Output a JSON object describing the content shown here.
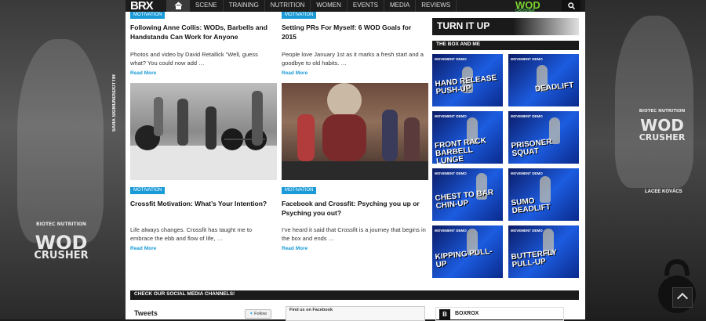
{
  "nav": {
    "logo": "BRX",
    "items": [
      "SCENE",
      "TRAINING",
      "NUTRITION",
      "WOMEN",
      "EVENTS",
      "MEDIA",
      "REVIEWS"
    ],
    "brand_logo": "WOD",
    "brand_logo_sub": "CRUSHER"
  },
  "side_left": {
    "name": "SARA SIGMUNDSDOTTIR",
    "shirt_line1": "WOD",
    "shirt_line2": "CRUSHER",
    "shirt_brand": "BIOTEC NUTRITION"
  },
  "side_right": {
    "name": "LACEE KOVÁCS",
    "shirt_line1": "WOD",
    "shirt_line2": "CRUSHER",
    "shirt_brand": "BIOTEC NUTRITION"
  },
  "articles": [
    {
      "tag": "MOTIVATION",
      "title": "Following Anne Collis: WODs, Barbells and Handstands Can Work for Anyone",
      "excerpt": "Photos and video by David Retallick “Well, guess what? You could now add …",
      "more": "Read More"
    },
    {
      "tag": "MOTIVATION",
      "title": "Setting PRs For Myself: 6 WOD Goals for 2015",
      "excerpt": "People love January 1st as it marks a fresh start and a goodbye to old habits. …",
      "more": "Read More"
    },
    {
      "tag": "MOTIVATION",
      "title": "Crossfit Motivation: What’s Your Intention?",
      "excerpt": "Life always changes. Crossfit has taught me to embrace the ebb and flow of life, …",
      "more": "Read More"
    },
    {
      "tag": "MOTIVATION",
      "title": "Facebook and Crossfit: Psyching you up or Psyching you out?",
      "excerpt": "I’ve heard it said that Crossfit is a journey that begins in the box and ends …",
      "more": "Read More"
    }
  ],
  "sidebar": {
    "turn_it_up": "TURN IT UP",
    "box_and_me": "THE BOX AND ME",
    "videos": [
      {
        "demo": "MOVEMENT DEMO",
        "label": "HAND RELEASE PUSH-UP"
      },
      {
        "demo": "MOVEMENT DEMO",
        "label": "DEADLIFT"
      },
      {
        "demo": "MOVEMENT DEMO",
        "label": "FRONT RACK BARBELL LUNGE"
      },
      {
        "demo": "MOVEMENT DEMO",
        "label": "PRISONER SQUAT"
      },
      {
        "demo": "MOVEMENT DEMO",
        "label": "CHEST TO BAR CHIN-UP"
      },
      {
        "demo": "MOVEMENT DEMO",
        "label": "SUMO DEADLIFT"
      },
      {
        "demo": "MOVEMENT DEMO",
        "label": "KIPPING PULL-UP"
      },
      {
        "demo": "MOVEMENT DEMO",
        "label": "BUTTERFLY PULL-UP"
      }
    ]
  },
  "social": {
    "heading": "CHECK OUR SOCIAL MEDIA CHANNELS!",
    "tweets_title": "Tweets",
    "follow_label": "Follow",
    "facebook_label": "Find us on Facebook",
    "boxrox_name": "BOXROX",
    "boxrox_icon": "B"
  },
  "colors": {
    "accent": "#1a9ad7",
    "navbar": "#1c1c1c",
    "brand_green": "#7bd12f"
  }
}
